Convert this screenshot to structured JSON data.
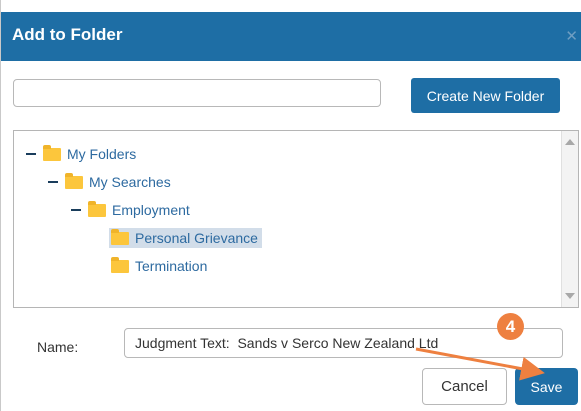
{
  "dialog": {
    "title": "Add to Folder",
    "close_icon": "close-icon"
  },
  "new_folder": {
    "input_value": "",
    "create_button_label": "Create New Folder"
  },
  "tree": {
    "nodes": [
      {
        "label": "My Folders",
        "level": 0,
        "expanded": true
      },
      {
        "label": "My Searches",
        "level": 1,
        "expanded": true
      },
      {
        "label": "Employment",
        "level": 2,
        "expanded": true
      },
      {
        "label": "Personal Grievance",
        "level": 3,
        "selected": true
      },
      {
        "label": "Termination",
        "level": 3
      }
    ]
  },
  "name_field": {
    "label": "Name:",
    "value": "Judgment Text:  Sands v Serco New Zealand Ltd"
  },
  "buttons": {
    "cancel_label": "Cancel",
    "save_label": "Save"
  },
  "annotation": {
    "step_number": "4",
    "color": "#ee8040"
  },
  "colors": {
    "header": "#1e6ea5",
    "folder": "#fcc63c",
    "selection": "#d2dde9"
  }
}
